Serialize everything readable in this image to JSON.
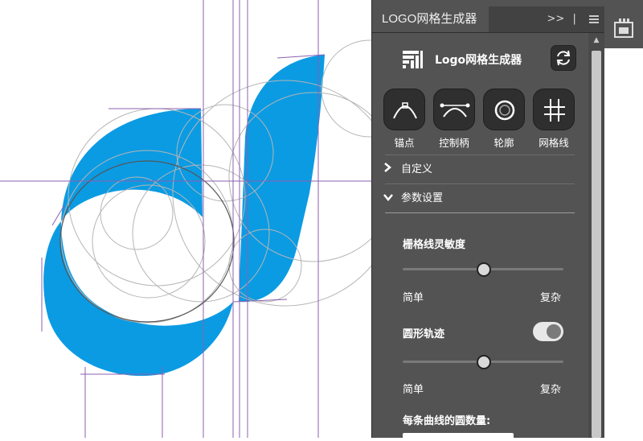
{
  "panel": {
    "tab_title": "LOGO网格生成器",
    "tab_expand_icon": "double-chevron-right-icon",
    "tab_menu_icon": "hamburger-menu-icon",
    "app_title": "Logo网格生成器",
    "tools": [
      {
        "label": "锚点",
        "icon": "anchor-point-icon"
      },
      {
        "label": "控制柄",
        "icon": "control-handle-icon"
      },
      {
        "label": "轮廓",
        "icon": "outline-icon"
      },
      {
        "label": "网格线",
        "icon": "grid-lines-icon"
      }
    ],
    "sections": {
      "custom": "自定义",
      "params": "参数设置"
    },
    "grid_sensitivity": {
      "label": "栅格线灵敏度",
      "value": 0.51,
      "min_label": "简单",
      "max_label": "复杂"
    },
    "circle_trace": {
      "label": "圆形轨迹",
      "enabled": true,
      "value": 0.51,
      "min_label": "简单",
      "max_label": "复杂"
    },
    "circles_per_curve": {
      "label": "每条曲线的圆数量:"
    }
  },
  "colors": {
    "logo_fill": "#0b9be3",
    "guide_purple": "#8c5fb0",
    "panel_bg": "#535353"
  }
}
